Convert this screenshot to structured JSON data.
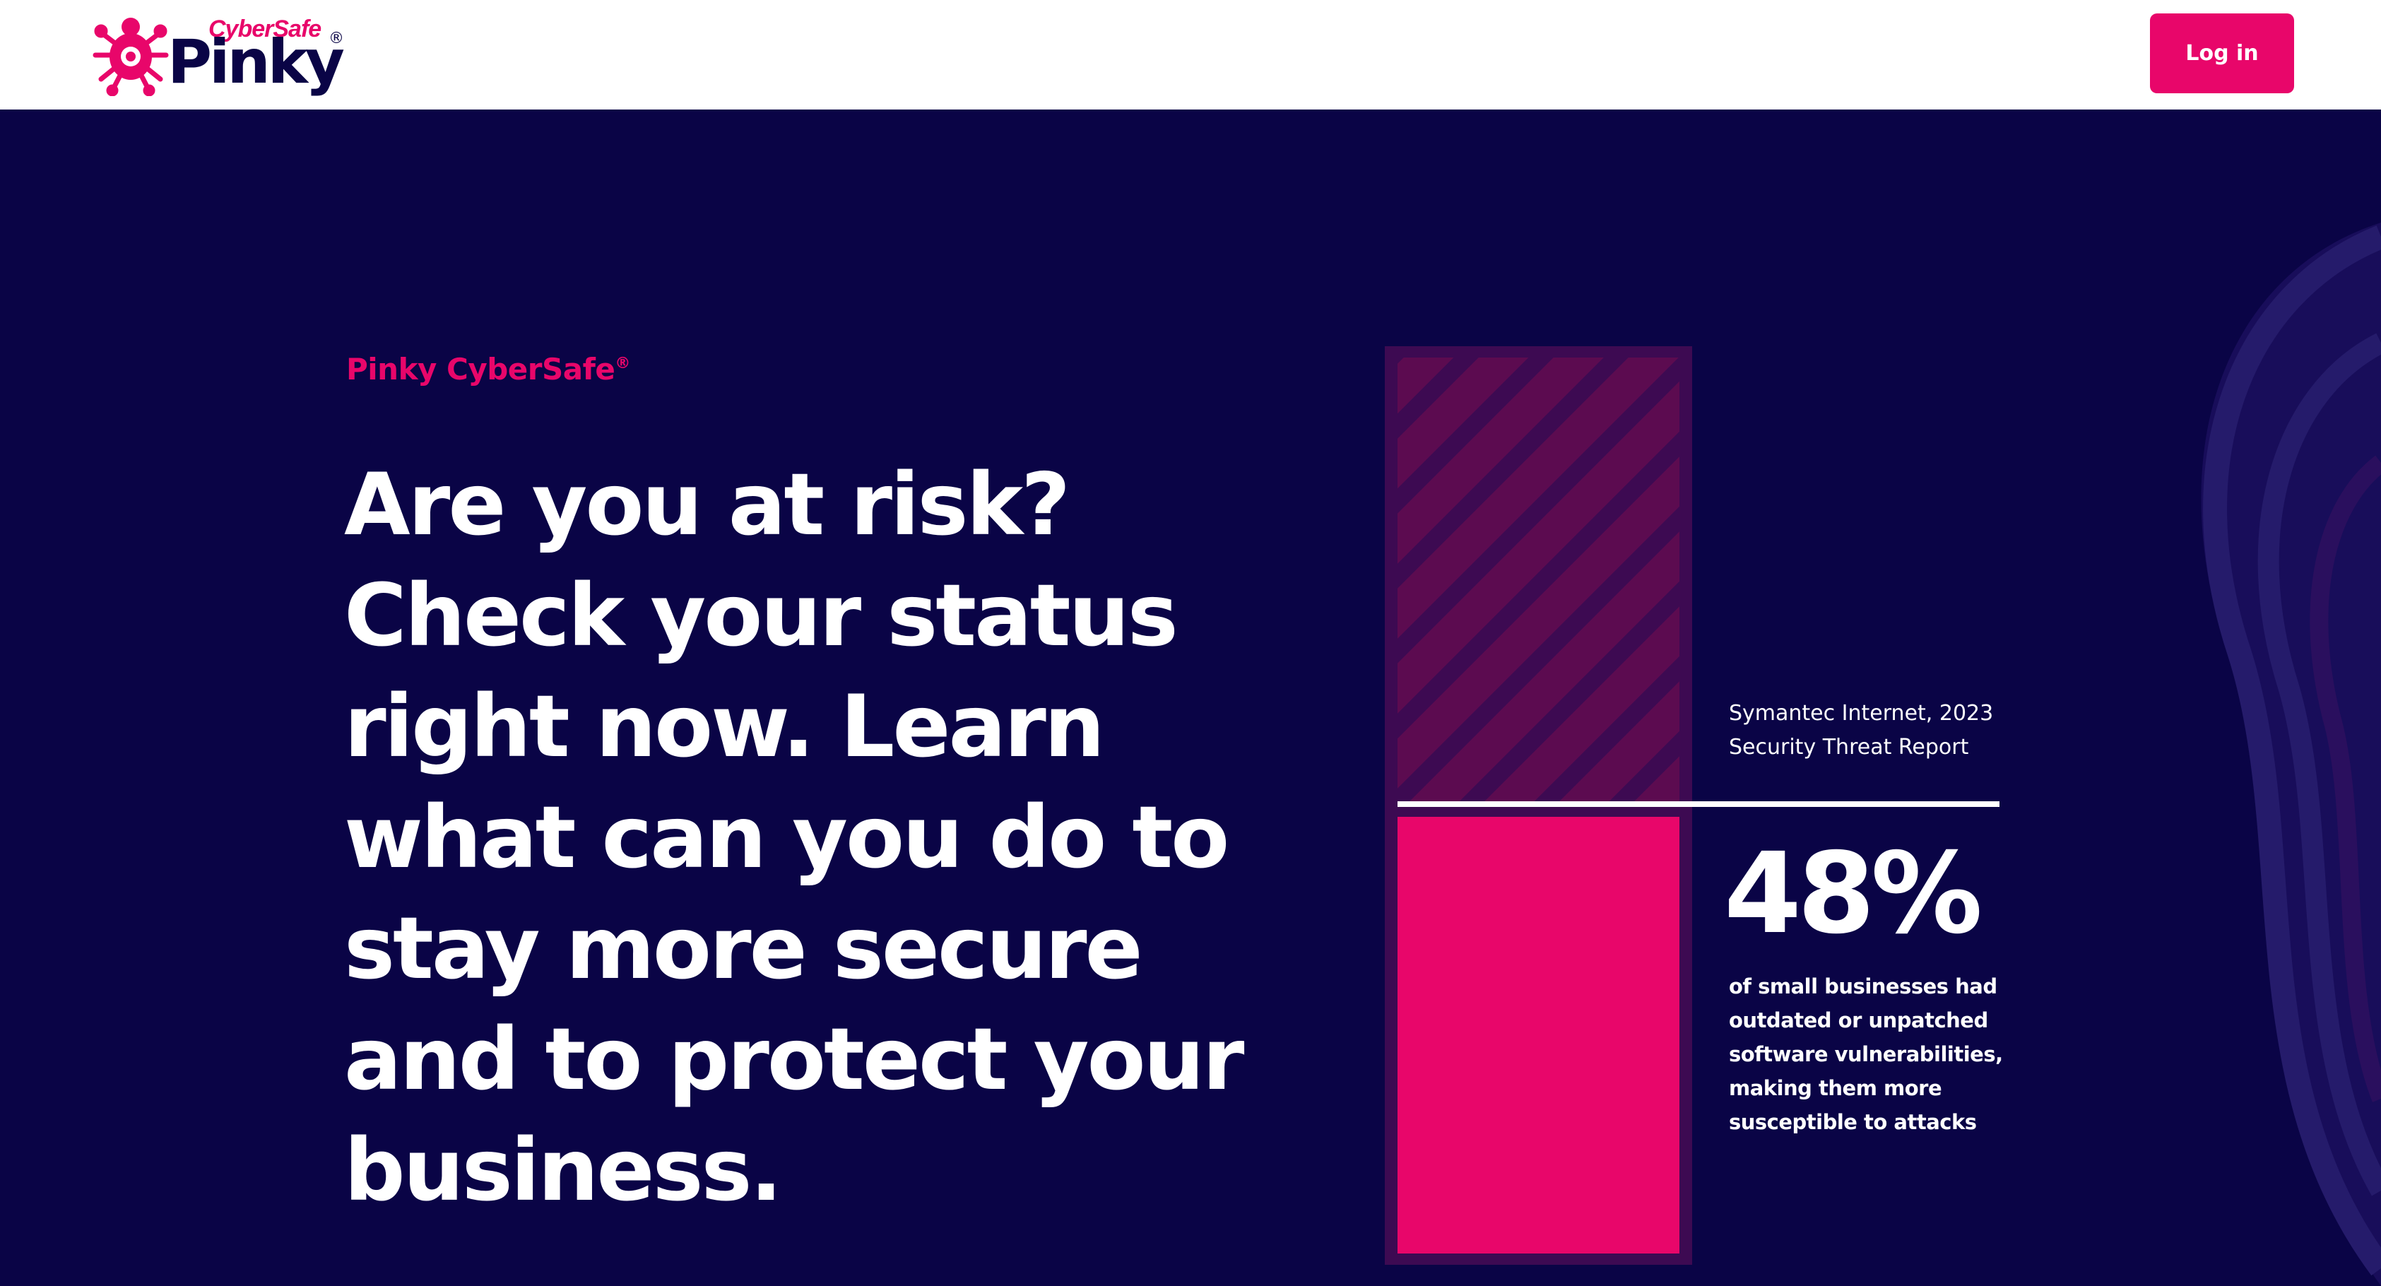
{
  "header": {
    "logo_small": "CyberSafe",
    "logo_big": "Pinky",
    "logo_mark": "®",
    "login_label": "Log in"
  },
  "hero": {
    "eyebrow": "Pinky CyberSafe",
    "eyebrow_mark": "®",
    "headline": "Are you at risk? Check your status right now. Learn what can you do to stay more secure and to protect your business."
  },
  "stat": {
    "source_line1": "Symantec Internet, 2023",
    "source_line2": "Security Threat Report",
    "value": "48%",
    "value_fraction": 0.48,
    "description": "of small businesses had outdated or unpatched software vulnerabilities, making them more susceptible to attacks"
  },
  "icons": {
    "logo": "spider-logo-icon"
  },
  "colors": {
    "brand_pink": "#e8066a",
    "navy_background": "#0a0446",
    "bar_dark": "#3d0a52",
    "bar_stripe": "#5c0b50",
    "white": "#ffffff"
  }
}
